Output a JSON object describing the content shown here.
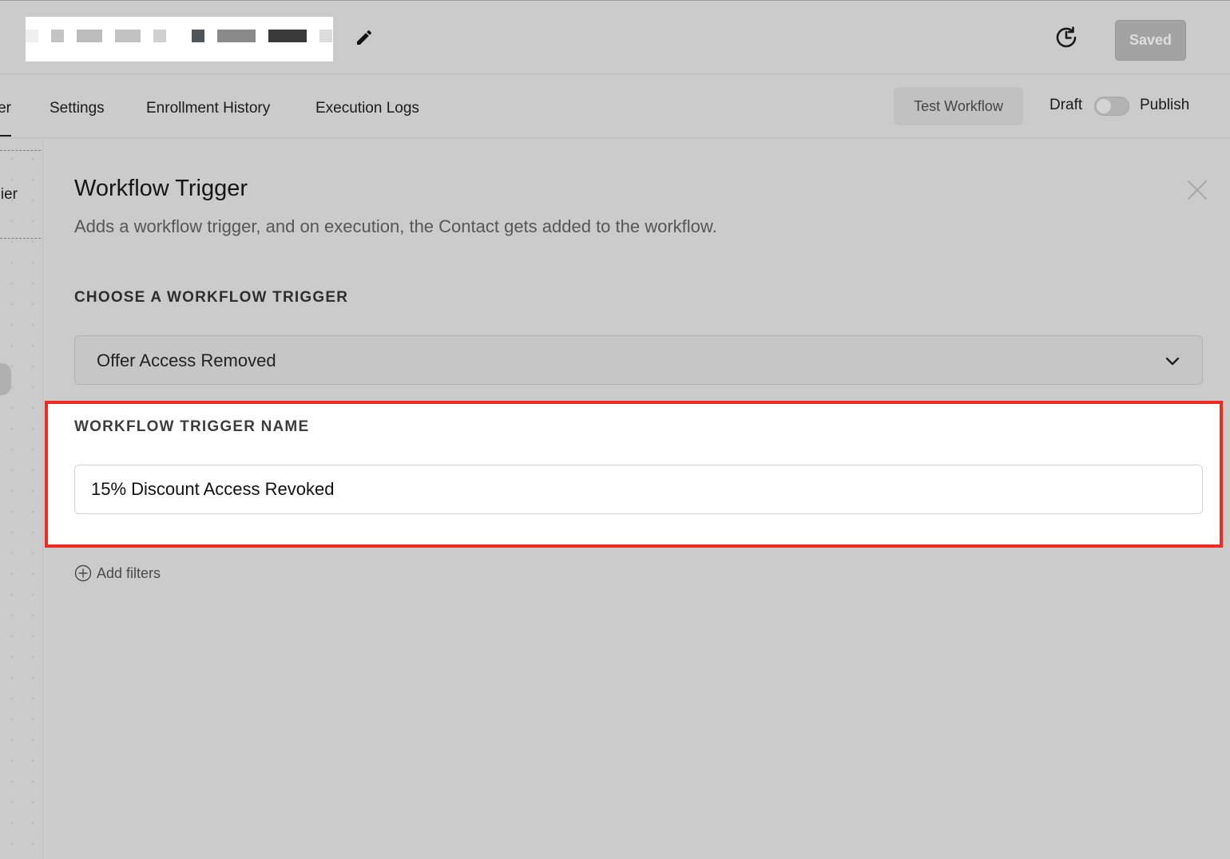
{
  "header": {
    "saved_label": "Saved"
  },
  "tabs": {
    "cut_tab_label": "er",
    "items": [
      {
        "label": "Settings"
      },
      {
        "label": "Enrollment History"
      },
      {
        "label": "Execution Logs"
      }
    ]
  },
  "toolbar": {
    "test_label": "Test Workflow",
    "draft_label": "Draft",
    "publish_label": "Publish",
    "publish_enabled": false
  },
  "canvas": {
    "partial_label": "ier"
  },
  "panel": {
    "title": "Workflow Trigger",
    "description": "Adds a workflow trigger, and on execution, the Contact gets added to the workflow.",
    "choose_label": "CHOOSE A WORKFLOW TRIGGER",
    "selected_trigger": "Offer Access Removed",
    "name_label": "WORKFLOW TRIGGER NAME",
    "name_value": "15% Discount Access Revoked",
    "add_filters_label": "Add filters"
  },
  "colors": {
    "highlight": "#ee2a24",
    "overlay": "#cbcbcb"
  },
  "icons": {
    "edit": "pencil-icon",
    "history": "history-icon",
    "close": "close-icon",
    "chevron": "chevron-down-icon",
    "add": "plus-circle-icon"
  }
}
